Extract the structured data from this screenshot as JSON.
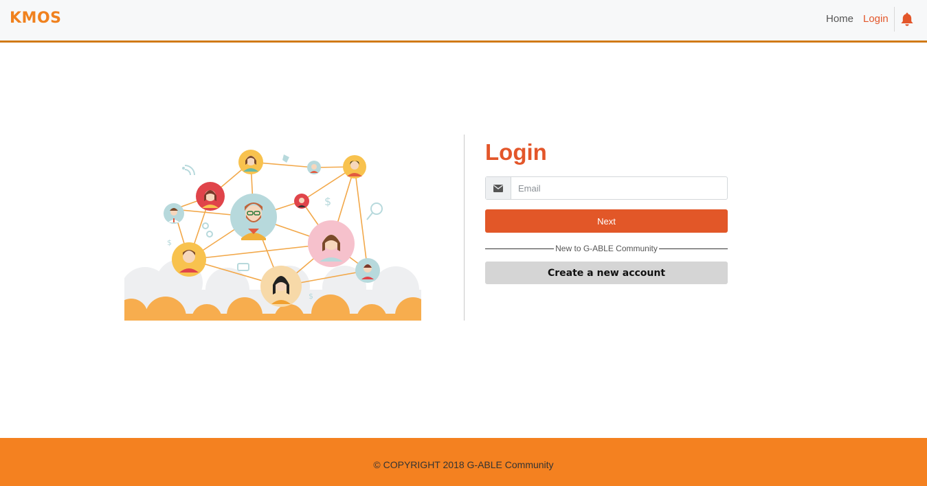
{
  "navbar": {
    "brand": "KMOS",
    "links": {
      "home": "Home",
      "login": "Login"
    },
    "notification_icon": "bell-icon"
  },
  "login_form": {
    "title": "Login",
    "email": {
      "placeholder": "Email",
      "value": "",
      "icon": "envelope-icon"
    },
    "next_label": "Next",
    "separator_text": "New to G-ABLE Community",
    "create_account_label": "Create a new account"
  },
  "footer": {
    "copyright": "© COPYRIGHT 2018 G-ABLE Community"
  },
  "colors": {
    "accent": "#e3562a",
    "brand": "#f0811e",
    "footer": "#f48120",
    "nav_border": "#d07a17",
    "secondary_button": "#d5d5d5"
  }
}
